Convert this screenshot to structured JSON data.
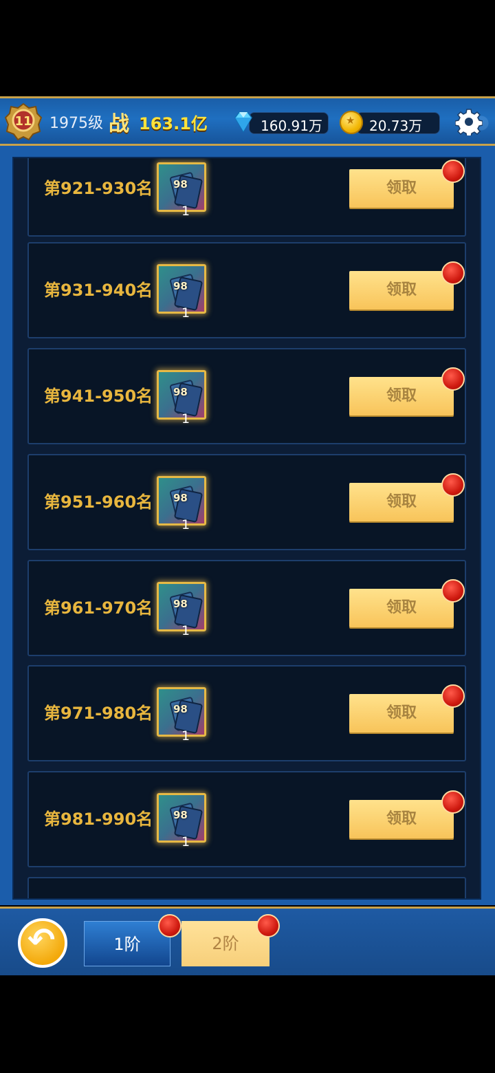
{
  "header": {
    "badge_level": "11",
    "player_level": "1975级",
    "power_label": "战",
    "power_value": "163.1亿",
    "gems": "160.91万",
    "gold": "20.73万"
  },
  "rewards": [
    {
      "rank": "第921-930名",
      "item_tag": "98",
      "count": "1",
      "button": "领取"
    },
    {
      "rank": "第931-940名",
      "item_tag": "98",
      "count": "1",
      "button": "领取"
    },
    {
      "rank": "第941-950名",
      "item_tag": "98",
      "count": "1",
      "button": "领取"
    },
    {
      "rank": "第951-960名",
      "item_tag": "98",
      "count": "1",
      "button": "领取"
    },
    {
      "rank": "第961-970名",
      "item_tag": "98",
      "count": "1",
      "button": "领取"
    },
    {
      "rank": "第971-980名",
      "item_tag": "98",
      "count": "1",
      "button": "领取"
    },
    {
      "rank": "第981-990名",
      "item_tag": "98",
      "count": "1",
      "button": "领取"
    }
  ],
  "tabs": {
    "tier1": "1阶",
    "tier2": "2阶"
  },
  "colors": {
    "rank_text": "#e8b63e",
    "claim_button": "#f8c45a",
    "notification_dot": "#cf1a10",
    "frame_blue": "#1b5dab"
  }
}
